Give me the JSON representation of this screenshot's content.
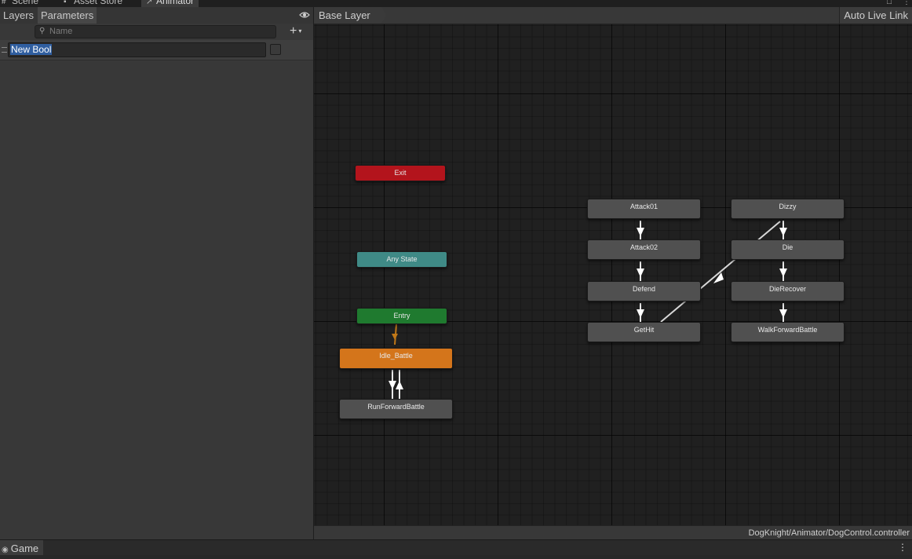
{
  "window_tabs": [
    {
      "label": "Scene",
      "icon": "hash-icon"
    },
    {
      "label": "Asset Store",
      "icon": "store-icon"
    },
    {
      "label": "Animator",
      "icon": "animator-icon"
    }
  ],
  "left_panel": {
    "tabs": [
      "Layers",
      "Parameters"
    ],
    "search_placeholder": "Name",
    "add_button": "+",
    "parameter": {
      "name": "New Bool",
      "type": "bool",
      "value": false
    }
  },
  "graph": {
    "breadcrumb": "Base Layer",
    "auto_live_link": "Auto Live Link",
    "states": {
      "exit": "Exit",
      "any_state": "Any State",
      "entry": "Entry",
      "idle_battle": "Idle_Battle",
      "run_forward_battle": "RunForwardBattle",
      "attack01": "Attack01",
      "attack02": "Attack02",
      "defend": "Defend",
      "get_hit": "GetHit",
      "dizzy": "Dizzy",
      "die": "Die",
      "die_recover": "DieRecover",
      "walk_forward_battle": "WalkForwardBattle"
    },
    "colors": {
      "exit": "#b3141c",
      "any_state": "#3f8a86",
      "entry": "#1f7a2f",
      "default_state": "#d4751b",
      "state": "#505050"
    }
  },
  "status": {
    "controller_path": "DogKnight/Animator/DogControl.controller"
  },
  "bottom": {
    "game_tab": "Game"
  }
}
